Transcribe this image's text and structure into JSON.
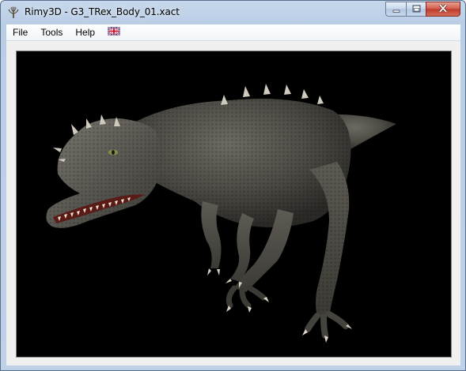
{
  "window": {
    "title": "Rimy3D - G3_TRex_Body_01.xact"
  },
  "icons": {
    "app": "tree-icon",
    "minimize": "minimize-icon",
    "maximize": "maximize-icon",
    "close": "close-icon",
    "language": "uk-flag-icon"
  },
  "menu": {
    "items": [
      {
        "label": "File"
      },
      {
        "label": "Tools"
      },
      {
        "label": "Help"
      }
    ]
  },
  "viewport": {
    "background": "#000000",
    "model": "t-rex-model"
  }
}
